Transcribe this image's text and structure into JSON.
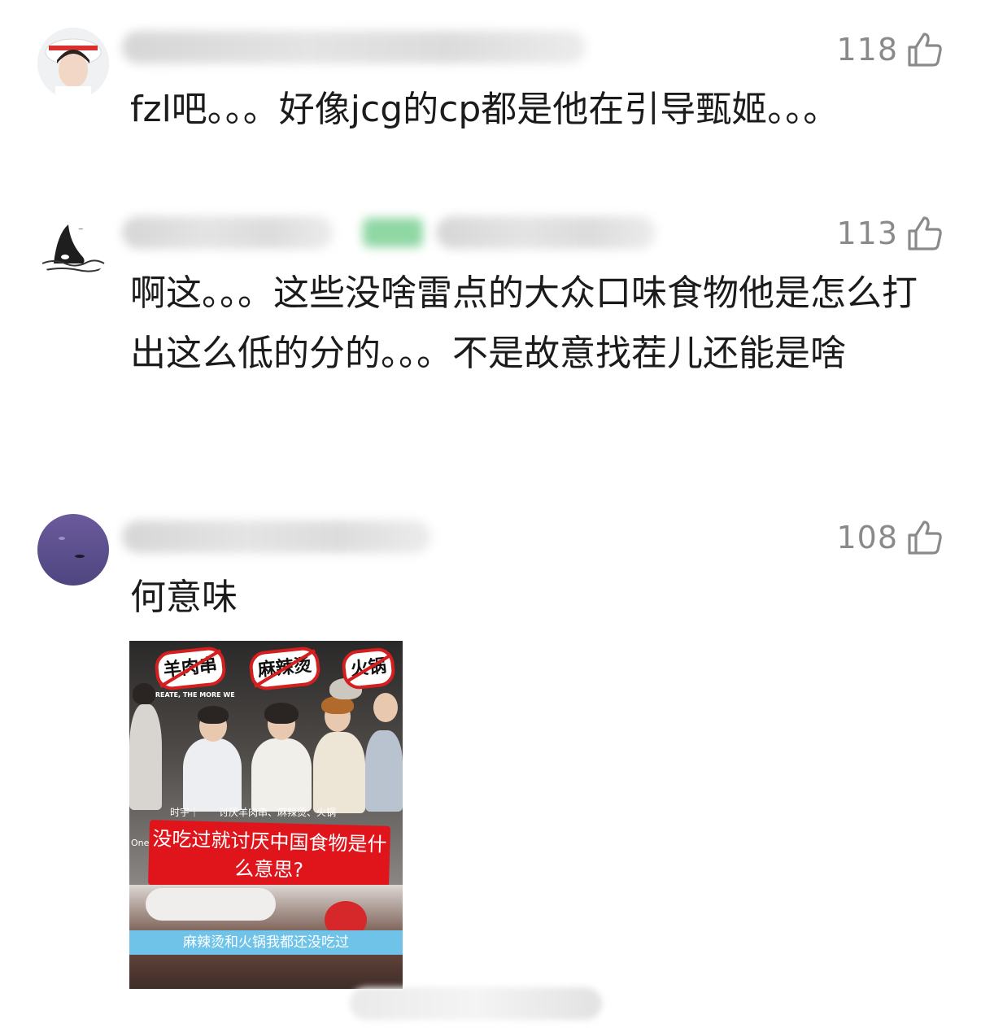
{
  "comments": [
    {
      "likes": "118",
      "text": "fzl吧。。。好像jcg的cp都是他在引导甄姬。。。"
    },
    {
      "likes": "113",
      "text": "啊这。。。这些没啥雷点的大众口味食物他是怎么打出这么低的分的。。。不是故意找茬儿还能是啥"
    },
    {
      "likes": "108",
      "text": "何意味",
      "image": {
        "tags": [
          "羊肉串",
          "麻辣烫",
          "火锅"
        ],
        "banner_text": "CREATE, THE MORE WE",
        "subtitle": "时宇｜　　讨厌羊肉串、麻辣烫、火锅",
        "headline": "没吃过就讨厌中国食物是什么意思?",
        "side_left": "One",
        "caption": "麻辣烫和火锅我都还没吃过"
      }
    }
  ],
  "icons": {
    "like": "thumbs-up-icon"
  },
  "colors": {
    "likes_text": "#8a8a8a",
    "red_box": "#e0141b",
    "blue_bar": "#6fc3e8"
  }
}
